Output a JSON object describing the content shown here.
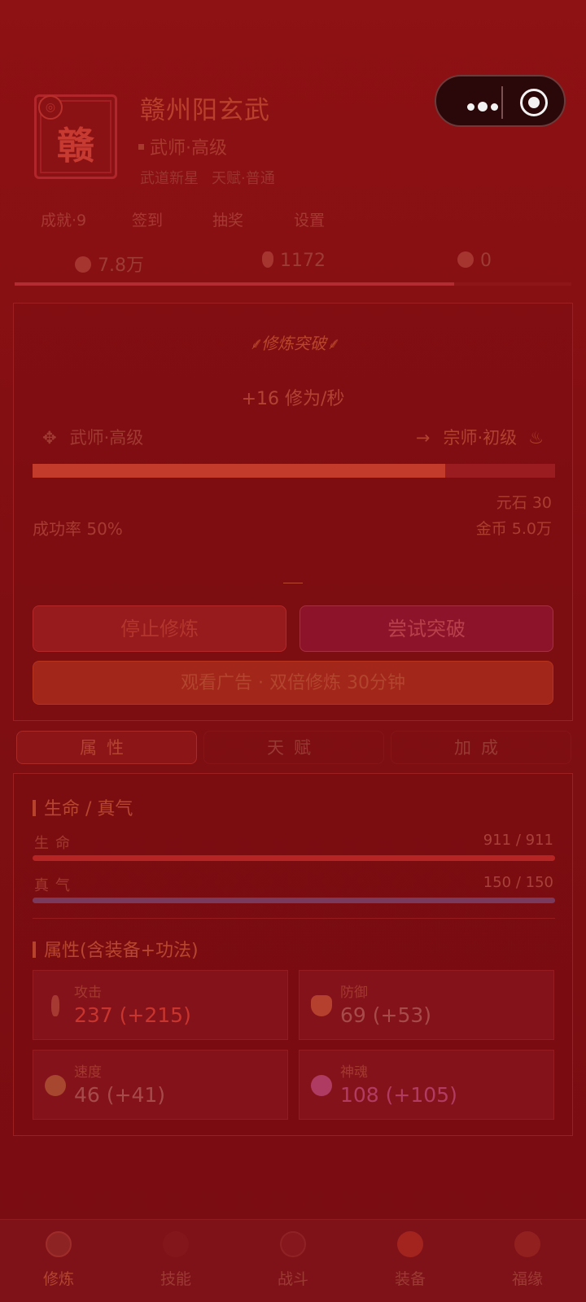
{
  "profile": {
    "avatar_char": "赣",
    "name": "赣州阳玄武",
    "rank": "武师·高级",
    "tag1": "武道新星",
    "tag2": "天赋·普通"
  },
  "menu": [
    "成就·9",
    "签到",
    "抽奖",
    "设置"
  ],
  "resources": {
    "gold": "7.8万",
    "stone": "1172",
    "soul": "0"
  },
  "exp_progress": 0.79,
  "cultivation": {
    "title": "修炼突破",
    "rate": "+16 修为/秒",
    "current_realm": "武师·高级",
    "arrow": "→",
    "next_realm": "宗师·初级",
    "progress": 0.79,
    "success_rate": "成功率 50%",
    "cost_stone": "元石 30",
    "cost_gold": "金币 5.0万",
    "stop_label": "停止修炼",
    "break_label": "尝试突破",
    "ad_label": "观看广告 · 双倍修炼 30分钟"
  },
  "tabs": [
    "属性",
    "天赋",
    "加成"
  ],
  "vitals": {
    "title": "生命 / 真气",
    "hp_label": "生命",
    "hp_value": "911 / 911",
    "hp_ratio": 1.0,
    "mp_label": "真气",
    "mp_value": "150 / 150",
    "mp_ratio": 1.0
  },
  "attributes": {
    "title": "属性(含装备+功法)",
    "items": [
      {
        "label": "攻击",
        "value": "237 (+215)",
        "color": "#c8352e"
      },
      {
        "label": "防御",
        "value": "69 (+53)",
        "color": "#a64a4a"
      },
      {
        "label": "速度",
        "value": "46 (+41)",
        "color": "#a64a4a"
      },
      {
        "label": "神魂",
        "value": "108 (+105)",
        "color": "#b23b62"
      }
    ]
  },
  "nav": [
    {
      "label": "修炼",
      "icon": "cultivate-icon",
      "active": true
    },
    {
      "label": "技能",
      "icon": "skill-icon",
      "active": false
    },
    {
      "label": "战斗",
      "icon": "battle-icon",
      "active": false
    },
    {
      "label": "装备",
      "icon": "equipment-icon",
      "active": false
    },
    {
      "label": "福缘",
      "icon": "fortune-icon",
      "active": false
    }
  ],
  "colors": {
    "background": "#8e1113",
    "accent": "#c33b2a",
    "hp_bar": "#b72424",
    "mp_bar": "#7a3a5e"
  }
}
